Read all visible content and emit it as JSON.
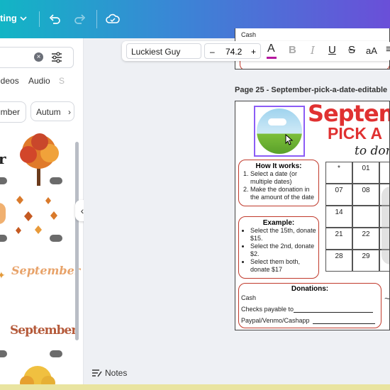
{
  "topbar": {
    "resize_label": "ting"
  },
  "sidebar": {
    "tabs": [
      "ideos",
      "Audio",
      "S"
    ],
    "chips": [
      "mber",
      "Autum"
    ],
    "sticker_text": "September"
  },
  "format": {
    "font": "Luckiest Guy",
    "size": "74.2",
    "minus": "–",
    "plus": "+",
    "text_color": "A",
    "bold": "B",
    "italic": "I",
    "underline": "U",
    "strike": "S",
    "case": "aA"
  },
  "canvas": {
    "prev_text": "Cash",
    "page_label": "Page 25 - September-pick-a-date-editable",
    "title1": "Septem",
    "title2": "PICK A",
    "title3": "to don",
    "how": {
      "heading": "How It works:",
      "items": [
        "Select a date (or multiple dates)",
        "Make the donation in the amount of the date"
      ]
    },
    "example": {
      "heading": "Example:",
      "items": [
        "Select the 15th, donate $15.",
        "Select the 2nd, donate $2.",
        "Select them both, donate $17"
      ]
    },
    "donations": {
      "heading": "Donations:",
      "cash": "Cash",
      "checks": "Checks payable to",
      "paypal": "Paypal/Venmo/Cashapp"
    },
    "grid": [
      "*",
      "01",
      "07",
      "08",
      "14",
      "21",
      "22",
      "28",
      "29"
    ]
  },
  "bottom": {
    "notes": "Notes"
  },
  "colors": {
    "accent_red": "#e03131",
    "brand_purple": "#7d2ae8"
  }
}
